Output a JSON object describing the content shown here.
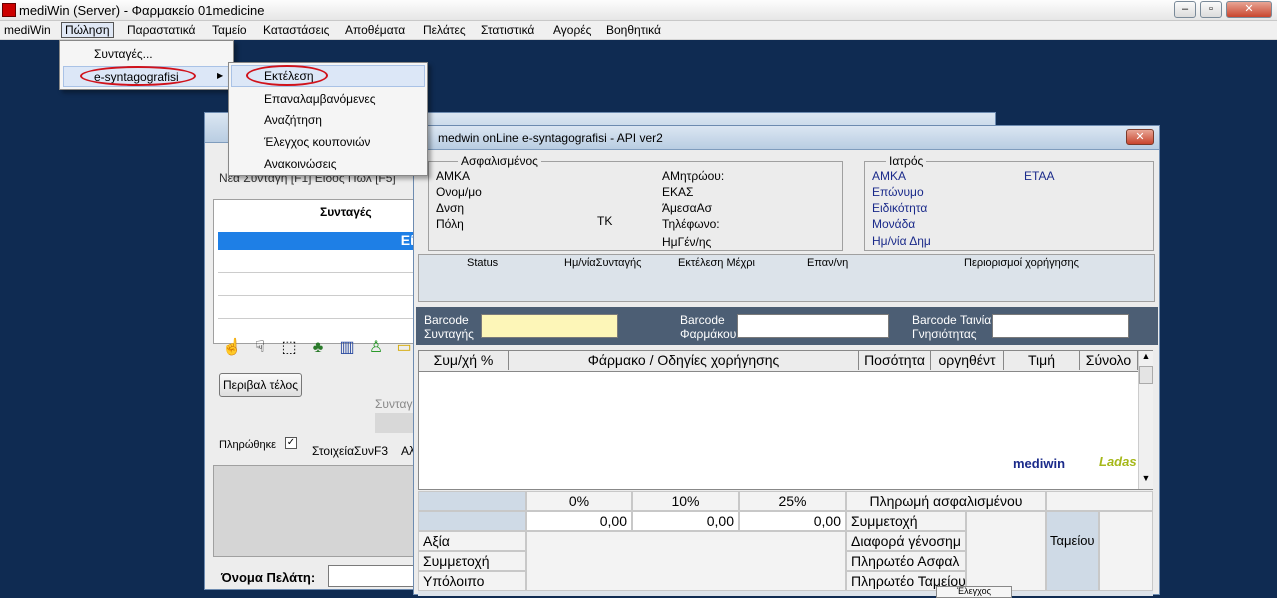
{
  "window": {
    "title": "mediWin (Server) - Φαρμακείο 01medicine",
    "min": "–",
    "max": "▫",
    "close": "✕"
  },
  "menu": [
    "mediWin",
    "Πώληση",
    "Παραστατικά",
    "Ταμείο",
    "Καταστάσεις",
    "Αποθέματα",
    "Πελάτες",
    "Στατιστικά",
    "Αγορές",
    "Βοηθητικά"
  ],
  "dropdown1": {
    "items": [
      "Συνταγές...",
      "e-syntagografisi"
    ],
    "arrow": "▶"
  },
  "dropdown2": {
    "items": [
      "Εκτέλεση",
      "Επαναλαμβανόμενες",
      "Αναζήτηση",
      "Έλεγχος κουπονιών",
      "Ανακοινώσεις"
    ]
  },
  "backwin": {
    "title": "",
    "header_partial": "Νέα Συνταγή [F1]   Είδος Πώλ [F5]",
    "tab": "Συνταγές",
    "selected_row": "Εί",
    "button": "Περιβαλ τέλος",
    "label_syntag": "Συνταγ",
    "paid": "Πληρώθηκε",
    "details": "ΣτοιχείαΣυνF3",
    "al": "Αλ",
    "customer_label": "Όνομα Πελάτη:"
  },
  "esyn": {
    "title": "medwin onLine e-syntagografisi - API ver2",
    "close": "✕",
    "insured": {
      "heading": "Ασφαλισμένος",
      "fields": [
        "ΑΜΚΑ",
        "Ονομ/μο",
        "Δνση",
        "Πόλη"
      ],
      "tk": "ΤΚ",
      "fields2": [
        "ΑΜητρώου:",
        "ΕΚΑΣ",
        "ΆμεσαΑσ",
        "Τηλέφωνο:",
        "ΗμΓέν/ης"
      ]
    },
    "doctor": {
      "heading": "Ιατρός",
      "fields": [
        "ΑΜΚΑ",
        "Επώνυμο",
        "Ειδικότητα",
        "Μονάδα",
        "Ημ/νία Δημ"
      ],
      "etaa": "ΕΤΑΑ"
    },
    "status_headers": [
      "Status",
      "Ημ/νίαΣυνταγής",
      "Εκτέλεση Μέχρι",
      "Επαν/νη",
      "Περιορισμοί χορήγησης"
    ],
    "barcode": {
      "syntagis": [
        "Barcode",
        "Συνταγής"
      ],
      "farmakou": [
        "Barcode",
        "Φαρμάκου"
      ],
      "tainia": [
        "Barcode Ταινία",
        "Γνησιότητας"
      ]
    },
    "grid_headers": [
      "Συμ/χή %",
      "Φάρμακο / Οδηγίες χορήγησης",
      "Ποσότητα",
      "οργηθέντ",
      "Τιμή",
      "Σύνολο"
    ],
    "logo_mediwin": "mediwin",
    "logo_ladas": "Ladas",
    "summary": {
      "pcts": [
        "0%",
        "10%",
        "25%"
      ],
      "values": [
        "0,00",
        "0,00",
        "0,00"
      ],
      "rows": [
        "Αξία",
        "Συμμετοχή",
        "Υπόλοιπο"
      ],
      "pay_heading": "Πληρωμή ασφαλισμένου",
      "pay_rows": [
        "Συμμετοχή",
        "Διαφορά γένοσημ",
        "Πληρωτέο Ασφαλ",
        "Πληρωτέο Ταμείου"
      ],
      "tameiou": "Ταμείου",
      "bottom_tab": "Έλεγχος"
    }
  }
}
